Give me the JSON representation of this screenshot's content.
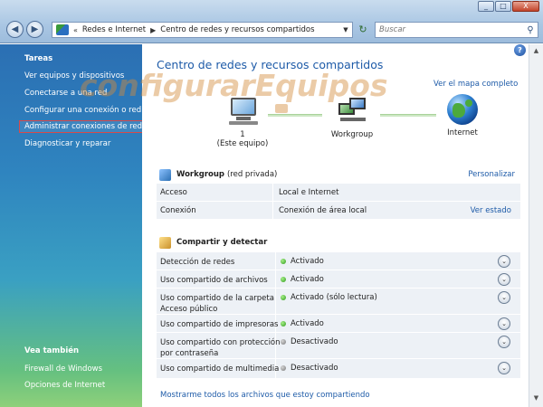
{
  "titlebar": {
    "buttons": [
      "_",
      "□",
      "X"
    ]
  },
  "address": {
    "breadcrumb": [
      "Redes e Internet",
      "Centro de redes y recursos compartidos"
    ],
    "search_placeholder": "Buscar"
  },
  "sidebar": {
    "tasks_heading": "Tareas",
    "tasks": [
      "Ver equipos y dispositivos",
      "Conectarse a una red",
      "Configurar una conexión o red",
      "Administrar conexiones de red",
      "Diagnosticar y reparar"
    ],
    "see_also_heading": "Vea también",
    "see_also": [
      "Firewall de Windows",
      "Opciones de Internet"
    ]
  },
  "main": {
    "title": "Centro de redes y recursos compartidos",
    "full_map_link": "Ver el mapa completo",
    "watermark": "configurarEquipos",
    "network_map": {
      "computer_number": "1",
      "computer_label": "(Este equipo)",
      "workgroup_label": "Workgroup",
      "internet_label": "Internet"
    },
    "network_section": {
      "name": "Workgroup",
      "type": "(red privada)",
      "customize": "Personalizar",
      "rows": [
        {
          "key": "Acceso",
          "value": "Local e Internet",
          "action": ""
        },
        {
          "key": "Conexión",
          "value": "Conexión de área local",
          "action": "Ver estado"
        }
      ]
    },
    "sharing_section": {
      "title": "Compartir y detectar",
      "rows": [
        {
          "key": "Detección de redes",
          "key2": "",
          "status": "Activado",
          "on": true
        },
        {
          "key": "Uso compartido de archivos",
          "key2": "",
          "status": "Activado",
          "on": true
        },
        {
          "key": "Uso compartido de la carpeta",
          "key2": "Acceso público",
          "status": "Activado (sólo lectura)",
          "on": true
        },
        {
          "key": "Uso compartido de impresoras",
          "key2": "",
          "status": "Activado",
          "on": true
        },
        {
          "key": "Uso compartido con protección",
          "key2": "por contraseña",
          "status": "Desactivado",
          "on": false
        },
        {
          "key": "Uso compartido de multimedia",
          "key2": "",
          "status": "Desactivado",
          "on": false
        }
      ],
      "show_all_link": "Mostrarme todos los archivos que estoy compartiendo"
    }
  },
  "colors": {
    "link": "#1e5ba8",
    "active_dot": "#2d9a1a",
    "sidebar_top": "#2b6fb3",
    "sidebar_bottom": "#8ed07a",
    "selection_border": "#d84a4a"
  },
  "icons": [
    "back-icon",
    "forward-icon",
    "network-folder-icon",
    "refresh-icon",
    "search-icon",
    "help-icon",
    "computer-icon",
    "workgroup-icon",
    "globe-icon",
    "network-icon",
    "sharing-icon",
    "expand-icon",
    "chevron-down-icon"
  ]
}
